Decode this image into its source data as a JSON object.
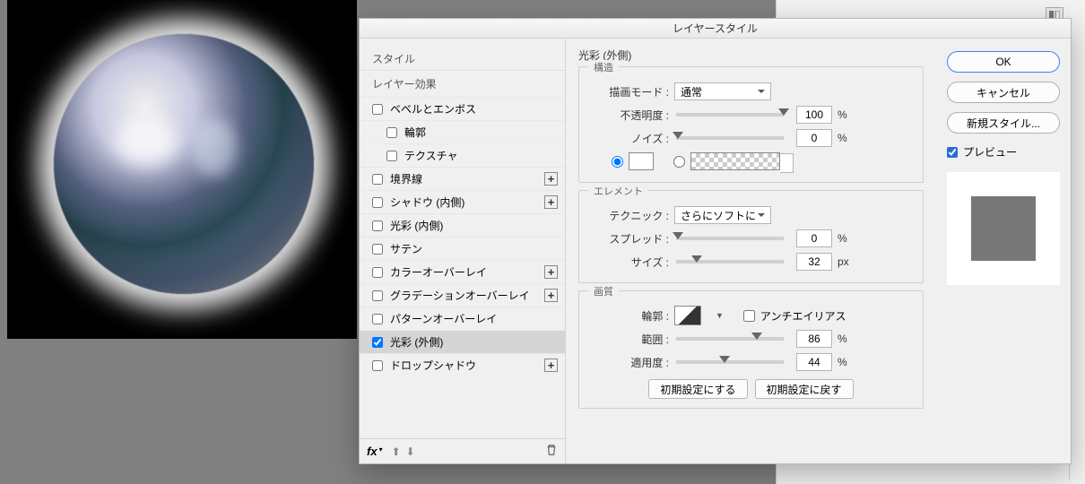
{
  "dialog": {
    "title": "レイヤースタイル",
    "left": {
      "styles_label": "スタイル",
      "effects_label": "レイヤー効果",
      "bevel": "ベベルとエンボス",
      "contour": "輪郭",
      "texture": "テクスチャ",
      "stroke": "境界線",
      "inner_shadow": "シャドウ (内側)",
      "inner_glow": "光彩 (内側)",
      "satin": "サテン",
      "color_overlay": "カラーオーバーレイ",
      "gradient_overlay": "グラデーションオーバーレイ",
      "pattern_overlay": "パターンオーバーレイ",
      "outer_glow": "光彩 (外側)",
      "drop_shadow": "ドロップシャドウ",
      "fx": "fx"
    },
    "mid": {
      "section_title": "光彩 (外側)",
      "structure": {
        "legend": "構造",
        "blend_mode_label": "描画モード :",
        "blend_mode_value": "通常",
        "opacity_label": "不透明度 :",
        "opacity_value": "100",
        "opacity_unit": "%",
        "noise_label": "ノイズ :",
        "noise_value": "0",
        "noise_unit": "%"
      },
      "element": {
        "legend": "エレメント",
        "technique_label": "テクニック :",
        "technique_value": "さらにソフトに",
        "spread_label": "スプレッド :",
        "spread_value": "0",
        "spread_unit": "%",
        "size_label": "サイズ :",
        "size_value": "32",
        "size_unit": "px"
      },
      "quality": {
        "legend": "画質",
        "contour_label": "輪郭 :",
        "antialias_label": "アンチエイリアス",
        "range_label": "範囲 :",
        "range_value": "86",
        "range_unit": "%",
        "jitter_label": "適用度 :",
        "jitter_value": "44",
        "jitter_unit": "%"
      },
      "make_default": "初期設定にする",
      "reset_default": "初期設定に戻す"
    },
    "right": {
      "ok": "OK",
      "cancel": "キャンセル",
      "new_style": "新規スタイル...",
      "preview": "プレビュー"
    }
  }
}
